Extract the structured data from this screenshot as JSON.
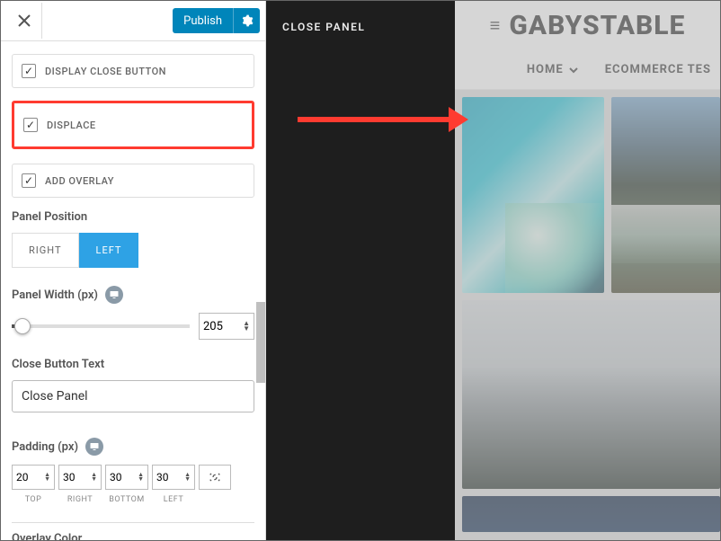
{
  "topbar": {
    "publish_label": "Publish"
  },
  "checkboxes": {
    "display_close_button": {
      "label": "DISPLAY CLOSE BUTTON",
      "checked": true
    },
    "displace": {
      "label": "DISPLACE",
      "checked": true
    },
    "add_overlay": {
      "label": "ADD OVERLAY",
      "checked": true
    }
  },
  "panel_position": {
    "label": "Panel Position",
    "options": [
      "RIGHT",
      "LEFT"
    ],
    "active": "LEFT"
  },
  "panel_width": {
    "label": "Panel Width (px)",
    "value": "205"
  },
  "close_button_text": {
    "label": "Close Button Text",
    "value": "Close Panel"
  },
  "padding": {
    "label": "Padding (px)",
    "values": {
      "top": "20",
      "right": "30",
      "bottom": "30",
      "left": "30"
    },
    "sublabels": {
      "top": "TOP",
      "right": "RIGHT",
      "bottom": "BOTTOM",
      "left": "LEFT"
    }
  },
  "overlay_color": {
    "label": "Overlay Color"
  },
  "preview": {
    "panel_text": "CLOSE PANEL",
    "site_title": "GABYSTABLE",
    "nav": {
      "home": "HOME",
      "ecom": "ECOMMERCE TES"
    }
  }
}
